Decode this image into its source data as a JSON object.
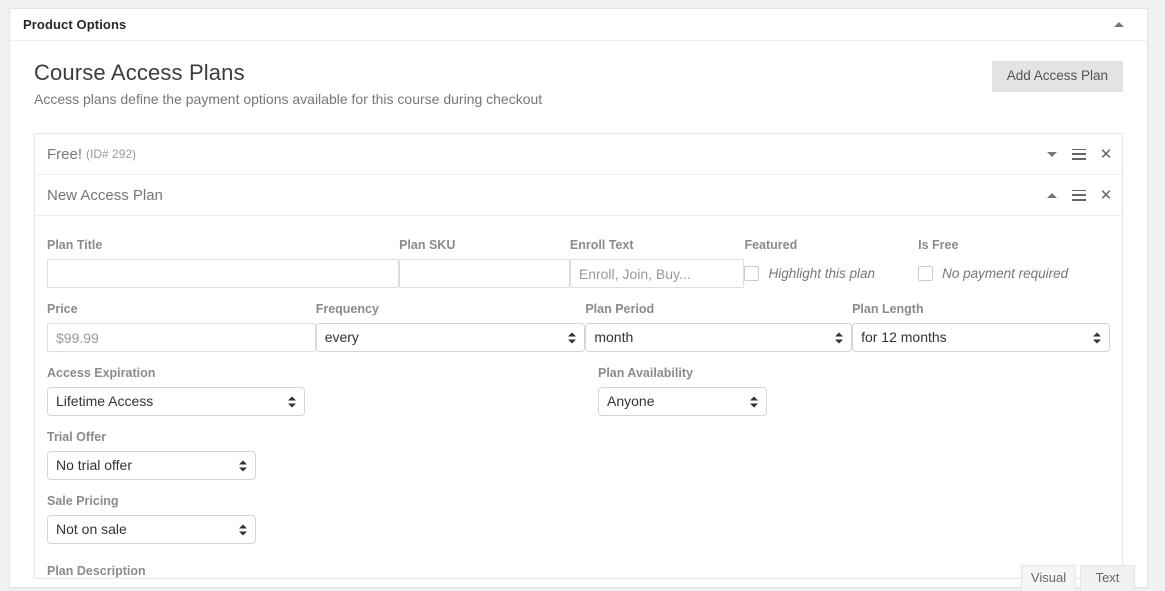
{
  "metabox": {
    "title": "Product Options",
    "toggle_icon": "triangle-up-icon"
  },
  "section": {
    "title": "Course Access Plans",
    "subtitle": "Access plans define the payment options available for this course during checkout",
    "add_button_label": "Add Access Plan"
  },
  "plans": [
    {
      "name": "Free!",
      "id_text": "(ID# 292)",
      "collapsed": true,
      "toggle_icon": "triangle-down-icon",
      "drag_icon": "hamburger-icon",
      "close_icon": "close-icon"
    },
    {
      "name": "New Access Plan",
      "id_text": "",
      "collapsed": false,
      "toggle_icon": "triangle-up-icon",
      "drag_icon": "hamburger-icon",
      "close_icon": "close-icon"
    }
  ],
  "form": {
    "plan_title": {
      "label": "Plan Title",
      "value": "",
      "placeholder": ""
    },
    "plan_sku": {
      "label": "Plan SKU",
      "value": "",
      "placeholder": ""
    },
    "enroll_text": {
      "label": "Enroll Text",
      "value": "",
      "placeholder": "Enroll, Join, Buy..."
    },
    "featured": {
      "label": "Featured",
      "checkbox_label": "Highlight this plan",
      "checked": false
    },
    "is_free": {
      "label": "Is Free",
      "checkbox_label": "No payment required",
      "checked": false
    },
    "price": {
      "label": "Price",
      "value": "",
      "placeholder": "$99.99"
    },
    "frequency": {
      "label": "Frequency",
      "value": "every"
    },
    "plan_period": {
      "label": "Plan Period",
      "value": "month"
    },
    "plan_length": {
      "label": "Plan Length",
      "value": "for 12 months"
    },
    "access_expiration": {
      "label": "Access Expiration",
      "value": "Lifetime Access"
    },
    "plan_availability": {
      "label": "Plan Availability",
      "value": "Anyone"
    },
    "trial_offer": {
      "label": "Trial Offer",
      "value": "No trial offer"
    },
    "sale_pricing": {
      "label": "Sale Pricing",
      "value": "Not on sale"
    },
    "plan_description": {
      "label": "Plan Description"
    }
  },
  "editor_tabs": [
    {
      "label": "Visual",
      "active": true
    },
    {
      "label": "Text",
      "active": false
    }
  ]
}
